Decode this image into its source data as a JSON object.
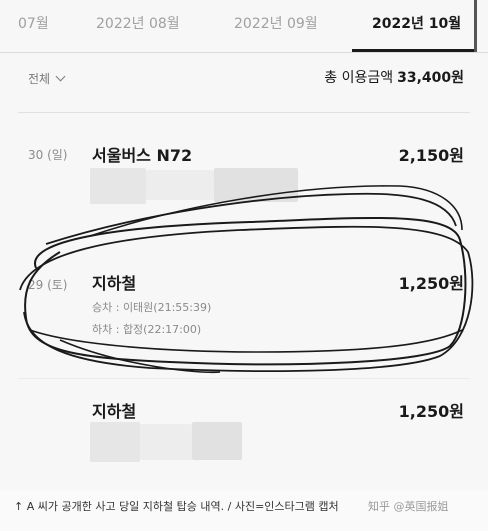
{
  "tabs": [
    {
      "label": "07월",
      "active": false
    },
    {
      "label": "2022년 08월",
      "active": false
    },
    {
      "label": "2022년 09월",
      "active": false
    },
    {
      "label": "2022년 10월",
      "active": true
    }
  ],
  "filter": {
    "label": "전체"
  },
  "summary": {
    "label": "총 이용금액",
    "amount": "33,400원"
  },
  "transactions": [
    {
      "date": "30 (일)",
      "title": "서울버스 N72",
      "amount": "2,150원"
    },
    {
      "date": "29 (토)",
      "title": "지하철",
      "amount": "1,250원",
      "boarding": "승차 : 이태원(21:55:39)",
      "alighting": "하차 : 합정(22:17:00)"
    },
    {
      "date": "",
      "title": "지하철",
      "amount": "1,250원"
    }
  ],
  "caption": "↑ A 씨가 공개한 사고 당일 지하철 탑승 내역. / 사진=인스타그램 캡처",
  "watermark": "知乎 @英国报姐",
  "colors": {
    "background": "#f7f7f7",
    "text": "#1a1a1a",
    "muted": "#8c8c8c",
    "scribble": "#1a1a1a"
  }
}
